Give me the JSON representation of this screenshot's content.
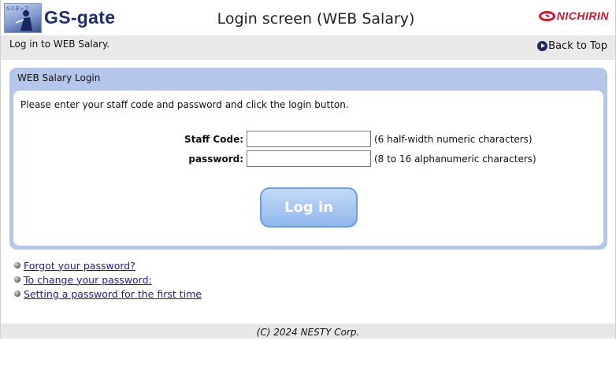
{
  "header": {
    "logo_tag": "Gスタッフ",
    "logo_text": "GS-gate",
    "page_title": "Login screen (WEB Salary)",
    "brand": "NICHIRIN",
    "brand_color": "#d7162c"
  },
  "subbar": {
    "text": "Log in to WEB Salary.",
    "back_link": "Back to Top",
    "back_icon": "play-circle-icon"
  },
  "panel": {
    "title": "WEB Salary Login",
    "instruction": "Please enter your staff code and password and click the login button.",
    "fields": [
      {
        "label": "Staff Code:",
        "value": "",
        "hint": "(6 half-width numeric characters)"
      },
      {
        "label": "password:",
        "value": "",
        "hint": "(8 to 16 alphanumeric characters)"
      }
    ],
    "login_button": "Log in",
    "panel_color": "#b4c6e9",
    "button_color": "#8fb7ec"
  },
  "links": [
    {
      "label": "Forgot your password?"
    },
    {
      "label": "To change your password:"
    },
    {
      "label": "Setting a password for the first time"
    }
  ],
  "footer": {
    "copyright": "(C) 2024 NESTY Corp."
  }
}
